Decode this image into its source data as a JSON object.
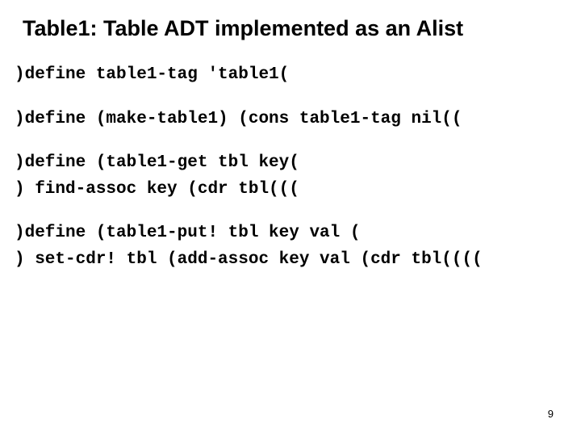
{
  "title": "Table1: Table ADT implemented as an Alist",
  "code": {
    "block1": ")define table1-tag 'table1(",
    "block2": ")define (make-table1) (cons table1-tag nil((",
    "block3_line1": ")define (table1-get tbl key(",
    "block3_line2": ") find-assoc key (cdr tbl(((",
    "block4_line1": ")define (table1-put! tbl key val (",
    "block4_line2": ") set-cdr! tbl (add-assoc key val (cdr tbl(((("
  },
  "page_number": "9"
}
